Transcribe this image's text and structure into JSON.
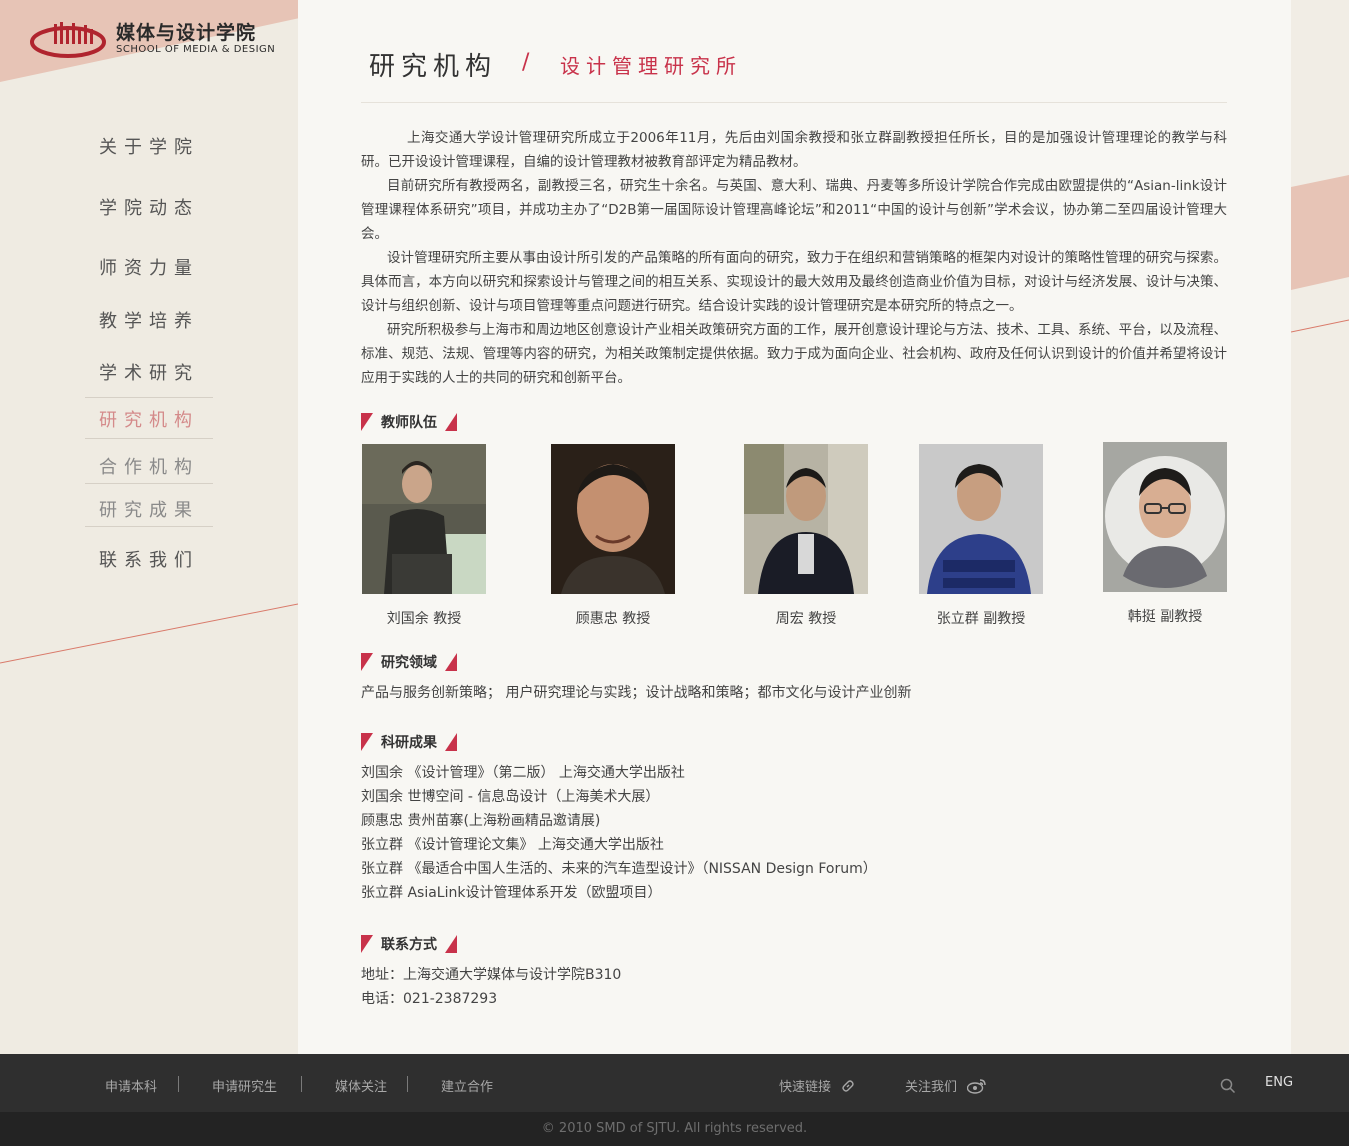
{
  "logo": {
    "cn": "媒体与设计学院",
    "en": "SCHOOL OF MEDIA & DESIGN"
  },
  "nav": {
    "items": [
      {
        "label": "关于学院"
      },
      {
        "label": "学院动态"
      },
      {
        "label": "师资力量"
      },
      {
        "label": "教学培养"
      },
      {
        "label": "学术研究"
      },
      {
        "label": "研究机构"
      },
      {
        "label": "合作机构"
      },
      {
        "label": "研究成果"
      },
      {
        "label": "联系我们"
      }
    ]
  },
  "header": {
    "title": "研究机构",
    "separator": "/",
    "subtitle": "设计管理研究所"
  },
  "intro": [
    "上海交通大学设计管理研究所成立于2006年11月，先后由刘国余教授和张立群副教授担任所长，目的是加强设计管理理论的教学与科研。已开设设计管理课程，自编的设计管理教材被教育部评定为精品教材。",
    "目前研究所有教授两名，副教授三名，研究生十余名。与英国、意大利、瑞典、丹麦等多所设计学院合作完成由欧盟提供的“Asian-link设计管理课程体系研究”项目，并成功主办了“D2B第一届国际设计管理高峰论坛”和2011“中国的设计与创新”学术会议，协办第二至四届设计管理大会。",
    "设计管理研究所主要从事由设计所引发的产品策略的所有面向的研究，致力于在组织和营销策略的框架内对设计的策略性管理的研究与探索。具体而言，本方向以研究和探索设计与管理之间的相互关系、实现设计的最大效用及最终创造商业价值为目标，对设计与经济发展、设计与决策、设计与组织创新、设计与项目管理等重点问题进行研究。结合设计实践的设计管理研究是本研究所的特点之一。",
    "研究所积极参与上海市和周边地区创意设计产业相关政策研究方面的工作，展开创意设计理论与方法、技术、工具、系统、平台，以及流程、标准、规范、法规、管理等内容的研究，为相关政策制定提供依据。致力于成为面向企业、社会机构、政府及任何认识到设计的价值并希望将设计应用于实践的人士的共同的研究和创新平台。"
  ],
  "sections": {
    "teachers": "教师队伍",
    "fields": "研究领域",
    "results": "科研成果",
    "contact": "联系方式"
  },
  "teachers": [
    {
      "name": "刘国余  教授"
    },
    {
      "name": "顾惠忠 教授"
    },
    {
      "name": "周宏  教授"
    },
    {
      "name": "张立群 副教授"
    },
    {
      "name": "韩挺  副教授"
    }
  ],
  "fields_text": "产品与服务创新策略； 用户研究理论与实践；设计战略和策略；都市文化与设计产业创新",
  "results": [
    "刘国余  《设计管理》（第二版） 上海交通大学出版社",
    "刘国余   世博空间 - 信息岛设计（上海美术大展）",
    "顾惠忠   贵州苗寨(上海粉画精品邀请展)",
    "张立群  《设计管理论文集》 上海交通大学出版社",
    "张立群   《最适合中国人生活的、未来的汽车造型设计》（NISSAN Design Forum）",
    "张立群  AsiaLink设计管理体系开发（欧盟项目）"
  ],
  "contact": {
    "address": "地址：上海交通大学媒体与设计学院B310",
    "phone": "电话：021-2387293"
  },
  "footer": {
    "links": [
      "申请本科",
      "申请研究生",
      "媒体关注",
      "建立合作"
    ],
    "quick_links": "快速链接",
    "follow": "关注我们",
    "lang": "ENG",
    "copyright": "© 2010 SMD of SJTU. All rights reserved."
  },
  "colors": {
    "accent": "#c8324a",
    "nav_active": "#d48a8a",
    "deco": "#e7c4b6",
    "footer_bg": "#2f2f2f"
  }
}
